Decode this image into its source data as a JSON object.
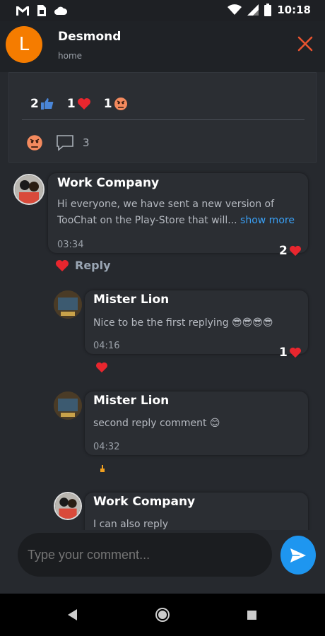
{
  "status_bar": {
    "time": "10:18",
    "icons": [
      "gmail-icon",
      "sim-card-icon",
      "cloud-icon",
      "wifi-icon",
      "signal-icon",
      "battery-icon"
    ]
  },
  "header": {
    "avatar_letter": "L",
    "title": "Desmond",
    "subtitle": "home"
  },
  "post": {
    "reactions": [
      {
        "count": "2",
        "icon": "thumbs-up-icon"
      },
      {
        "count": "1",
        "icon": "heart-icon"
      },
      {
        "count": "1",
        "icon": "angry-face-icon"
      }
    ],
    "comment_count": "3"
  },
  "comments": [
    {
      "name": "Work Company",
      "text": "Hi everyone, we have sent a new version of TooChat on the Play-Store that will...",
      "more": "show more",
      "time": "03:34",
      "hearts": "2",
      "reply_label": "Reply"
    },
    {
      "name": "Mister Lion",
      "text": "Nice to be the first replying 😎😎😎😎",
      "time": "04:16",
      "hearts": "1"
    },
    {
      "name": "Mister Lion",
      "text": "second reply comment 😊",
      "time": "04:32"
    },
    {
      "name": "Work Company",
      "text": "I can also reply"
    }
  ],
  "composer": {
    "placeholder": "Type your comment..."
  },
  "colors": {
    "accent": "#1e96f0",
    "avatar": "#f57c00",
    "close": "#e8532f",
    "heart": "#e8262e",
    "link": "#3aa0f5"
  }
}
